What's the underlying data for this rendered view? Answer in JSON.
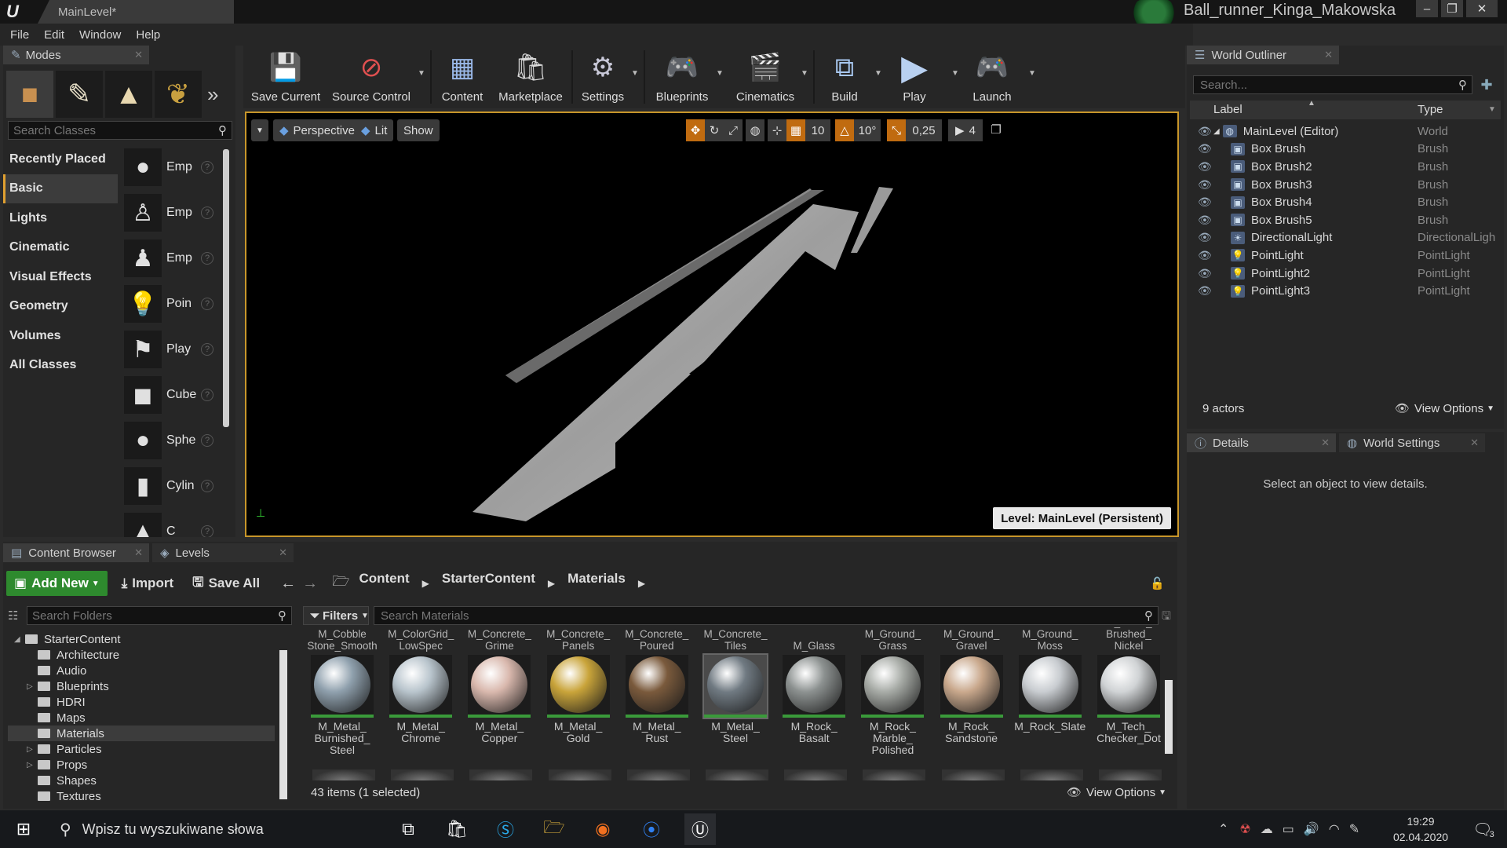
{
  "titlebar": {
    "app_logo": "U",
    "doc_tab": "MainLevel*",
    "project_name": "Ball_runner_Kinga_Makowska",
    "min": "–",
    "restore": "❐",
    "close": "✕"
  },
  "menu": [
    "File",
    "Edit",
    "Window",
    "Help"
  ],
  "modes": {
    "tab": "Modes",
    "more": "»",
    "search_placeholder": "Search Classes",
    "categories": [
      "Recently Placed",
      "Basic",
      "Lights",
      "Cinematic",
      "Visual Effects",
      "Geometry",
      "Volumes",
      "All Classes"
    ],
    "selected_category": "Basic",
    "place_items": [
      "Emp",
      "Emp",
      "Emp",
      "Poin",
      "Play",
      "Cube",
      "Sphe",
      "Cylin",
      "C"
    ]
  },
  "toolbar": {
    "save_current": "Save Current",
    "source_control": "Source Control",
    "content": "Content",
    "marketplace": "Marketplace",
    "settings": "Settings",
    "blueprints": "Blueprints",
    "cinematics": "Cinematics",
    "build": "Build",
    "play": "Play",
    "launch": "Launch"
  },
  "viewport": {
    "perspective": "Perspective",
    "lit": "Lit",
    "show": "Show",
    "grid_snap": "10",
    "rotation_snap": "10°",
    "scale_snap": "0,25",
    "camera_speed": "4",
    "level_label": "Level:  MainLevel (Persistent)"
  },
  "outliner": {
    "tab": "World Outliner",
    "search_placeholder": "Search...",
    "col_label": "Label",
    "col_type": "Type",
    "rows": [
      {
        "label": "MainLevel (Editor)",
        "type": "World",
        "indent": 0
      },
      {
        "label": "Box Brush",
        "type": "Brush",
        "indent": 1
      },
      {
        "label": "Box Brush2",
        "type": "Brush",
        "indent": 1
      },
      {
        "label": "Box Brush3",
        "type": "Brush",
        "indent": 1
      },
      {
        "label": "Box Brush4",
        "type": "Brush",
        "indent": 1
      },
      {
        "label": "Box Brush5",
        "type": "Brush",
        "indent": 1
      },
      {
        "label": "DirectionalLight",
        "type": "DirectionalLigh",
        "indent": 1
      },
      {
        "label": "PointLight",
        "type": "PointLight",
        "indent": 1
      },
      {
        "label": "PointLight2",
        "type": "PointLight",
        "indent": 1
      },
      {
        "label": "PointLight3",
        "type": "PointLight",
        "indent": 1
      }
    ],
    "actor_count": "9 actors",
    "view_options": "View Options"
  },
  "details": {
    "tab_details": "Details",
    "tab_world_settings": "World Settings",
    "empty_message": "Select an object to view details."
  },
  "content_browser": {
    "tab": "Content Browser",
    "tab_levels": "Levels",
    "add_new": "Add New",
    "import": "Import",
    "save_all": "Save All",
    "breadcrumb": [
      "Content",
      "StarterContent",
      "Materials"
    ],
    "folder_search_placeholder": "Search Folders",
    "folders": [
      {
        "name": "StarterContent",
        "level": 0,
        "expander": "◢"
      },
      {
        "name": "Architecture",
        "level": 1,
        "expander": ""
      },
      {
        "name": "Audio",
        "level": 1,
        "expander": ""
      },
      {
        "name": "Blueprints",
        "level": 1,
        "expander": "▷"
      },
      {
        "name": "HDRI",
        "level": 1,
        "expander": ""
      },
      {
        "name": "Maps",
        "level": 1,
        "expander": ""
      },
      {
        "name": "Materials",
        "level": 1,
        "expander": ""
      },
      {
        "name": "Particles",
        "level": 1,
        "expander": "▷"
      },
      {
        "name": "Props",
        "level": 1,
        "expander": "▷"
      },
      {
        "name": "Shapes",
        "level": 1,
        "expander": ""
      },
      {
        "name": "Textures",
        "level": 1,
        "expander": ""
      }
    ],
    "selected_folder": "Materials",
    "filters": "Filters",
    "materials_search_placeholder": "Search Materials",
    "top_row_names": [
      "M_Cobble\nStone_Smooth",
      "M_ColorGrid_\nLowSpec",
      "M_Concrete_\nGrime",
      "M_Concrete_\nPanels",
      "M_Concrete_\nPoured",
      "M_Concrete_\nTiles",
      "M_Glass",
      "M_Ground_\nGrass",
      "M_Ground_\nGravel",
      "M_Ground_\nMoss",
      "M_Metal_\nBrushed_\nNickel"
    ],
    "assets": [
      {
        "name": "M_Metal_\nBurnished_\nSteel",
        "color": "#8fa0ad"
      },
      {
        "name": "M_Metal_\nChrome",
        "color": "#b8c4cc"
      },
      {
        "name": "M_Metal_\nCopper",
        "color": "#d9b8ad"
      },
      {
        "name": "M_Metal_\nGold",
        "color": "#c9a43a"
      },
      {
        "name": "M_Metal_\nRust",
        "color": "#7a5a3c"
      },
      {
        "name": "M_Metal_\nSteel",
        "color": "#707a82"
      },
      {
        "name": "M_Rock_\nBasalt",
        "color": "#8c9190"
      },
      {
        "name": "M_Rock_\nMarble_\nPolished",
        "color": "#a7aba6"
      },
      {
        "name": "M_Rock_\nSandstone",
        "color": "#c9a88c"
      },
      {
        "name": "M_Rock_Slate",
        "color": "#c8ccd0"
      },
      {
        "name": "M_Tech_\nChecker_Dot",
        "color": "#d0d3d5"
      }
    ],
    "selected_asset": "M_Metal_\nSteel",
    "item_count": "43 items (1 selected)",
    "view_options": "View Options"
  },
  "taskbar": {
    "search_placeholder": "Wpisz tu wyszukiwane słowa",
    "time": "19:29",
    "date": "02.04.2020",
    "notifications": "3"
  }
}
